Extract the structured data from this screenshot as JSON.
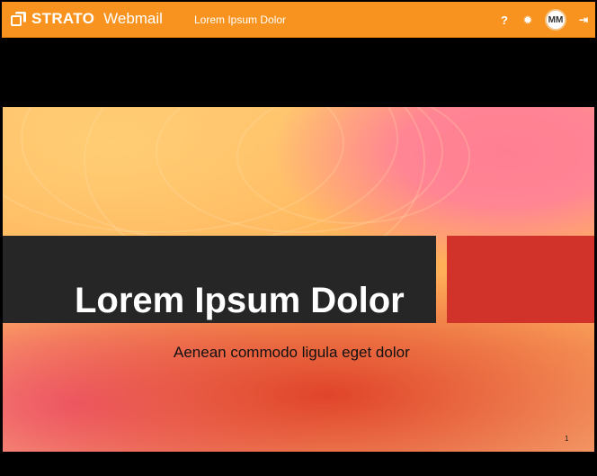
{
  "app": {
    "brand_primary": "STRATO",
    "brand_secondary": "Webmail",
    "document_title": "Lorem Ipsum Dolor",
    "accent_color": "#f7931e"
  },
  "toolbar": {
    "help_icon": "question-icon",
    "help_glyph": "?",
    "settings_icon": "gear-icon",
    "settings_glyph": "✹",
    "user_initials": "MM",
    "logout_icon": "logout-icon",
    "logout_glyph": "⇥"
  },
  "slide": {
    "title": "Lorem Ipsum Dolor",
    "subtitle": "Aenean commodo ligula eget dolor",
    "page_number": "1"
  }
}
